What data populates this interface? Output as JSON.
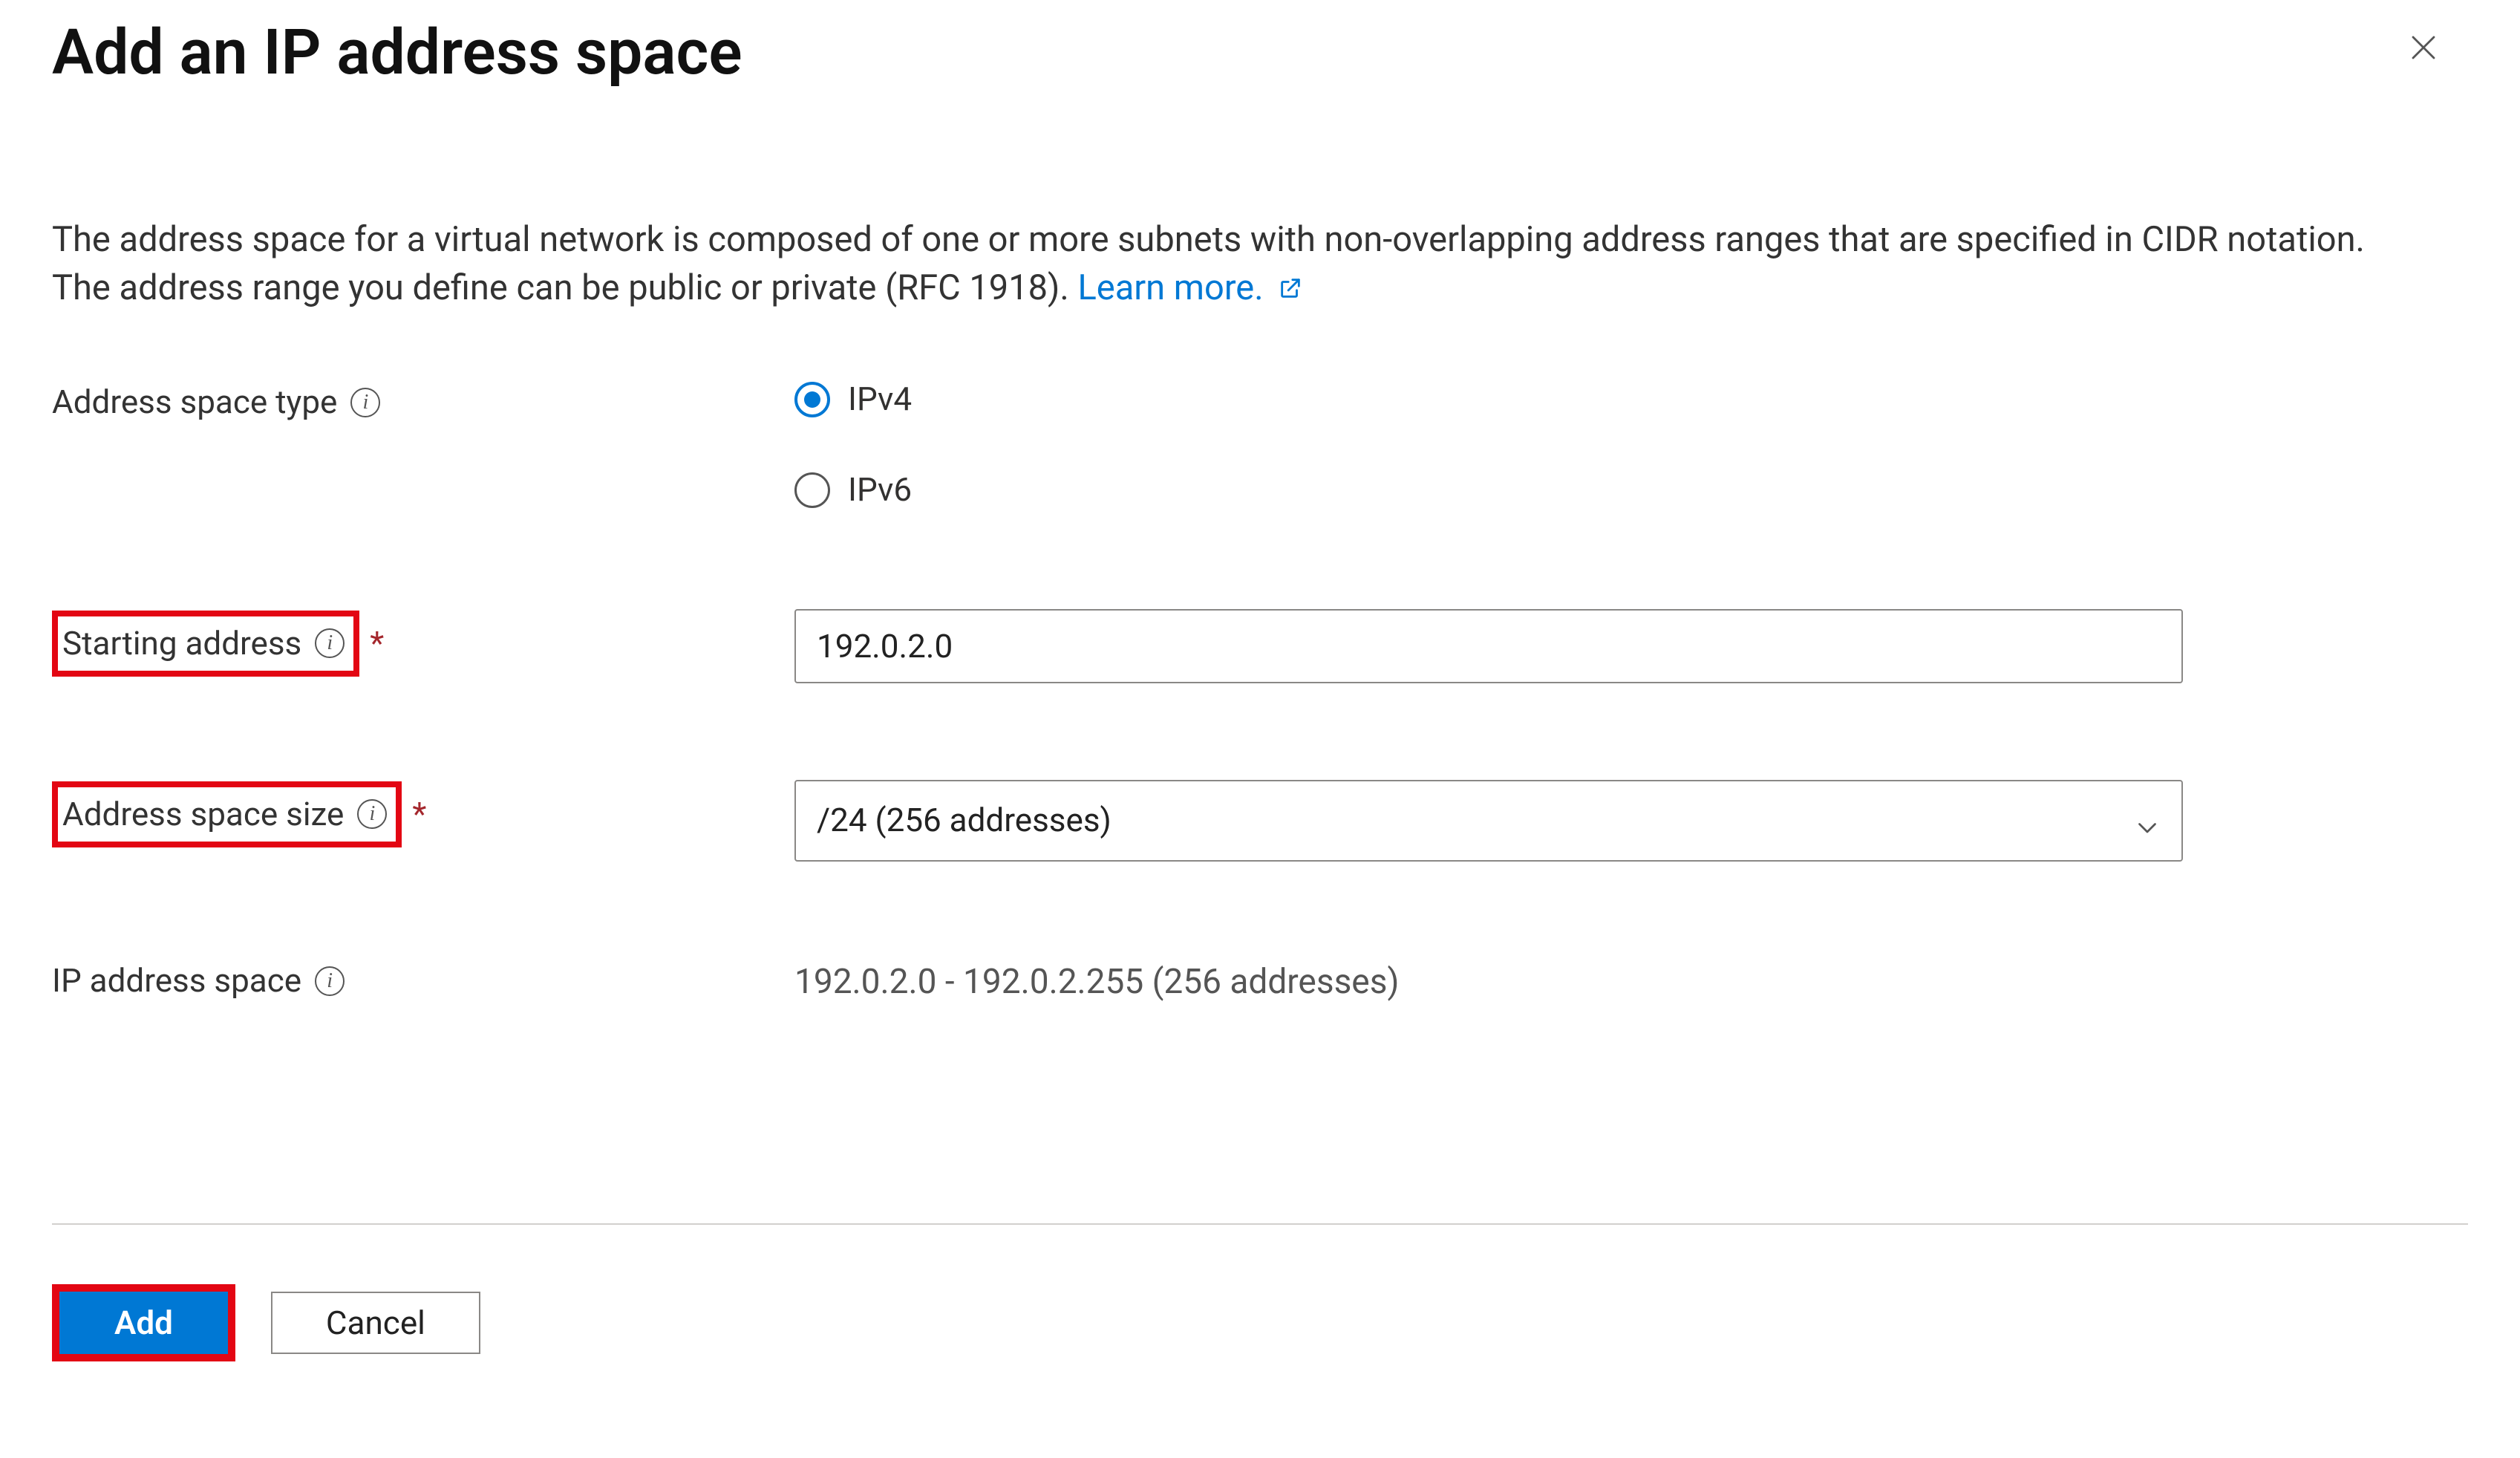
{
  "title": "Add an IP address space",
  "close_aria": "Close",
  "description": {
    "text_before_link": "The address space for a virtual network is composed of one or more subnets with non-overlapping address ranges that are specified in CIDR notation. The address range you define can be public or private (RFC 1918). ",
    "link_text": "Learn more."
  },
  "labels": {
    "address_space_type": "Address space type",
    "starting_address": "Starting address",
    "address_space_size": "Address space size",
    "ip_address_space": "IP address space"
  },
  "radios": {
    "ipv4": "IPv4",
    "ipv6": "IPv6"
  },
  "inputs": {
    "starting_address_value": "192.0.2.0",
    "address_space_size_value": "/24 (256 addresses)"
  },
  "readonly": {
    "ip_address_space_value": "192.0.2.0 - 192.0.2.255 (256 addresses)"
  },
  "buttons": {
    "add": "Add",
    "cancel": "Cancel"
  }
}
